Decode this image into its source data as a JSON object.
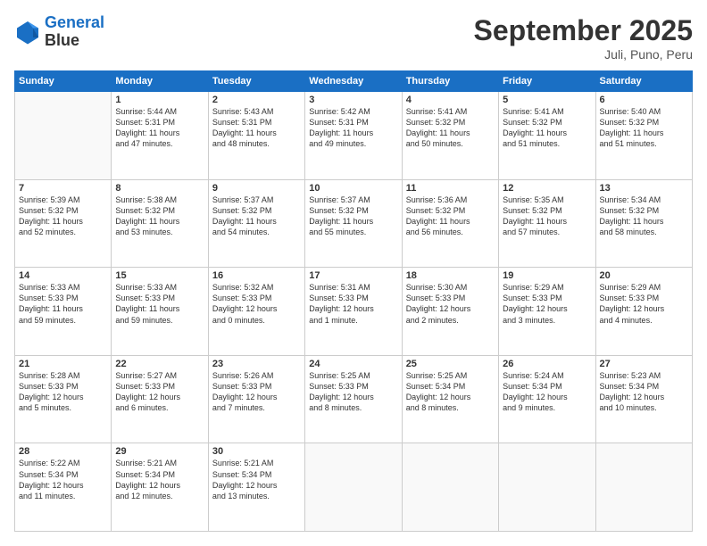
{
  "logo": {
    "line1": "General",
    "line2": "Blue"
  },
  "title": "September 2025",
  "location": "Juli, Puno, Peru",
  "days_header": [
    "Sunday",
    "Monday",
    "Tuesday",
    "Wednesday",
    "Thursday",
    "Friday",
    "Saturday"
  ],
  "weeks": [
    [
      {
        "day": "",
        "info": ""
      },
      {
        "day": "1",
        "info": "Sunrise: 5:44 AM\nSunset: 5:31 PM\nDaylight: 11 hours\nand 47 minutes."
      },
      {
        "day": "2",
        "info": "Sunrise: 5:43 AM\nSunset: 5:31 PM\nDaylight: 11 hours\nand 48 minutes."
      },
      {
        "day": "3",
        "info": "Sunrise: 5:42 AM\nSunset: 5:31 PM\nDaylight: 11 hours\nand 49 minutes."
      },
      {
        "day": "4",
        "info": "Sunrise: 5:41 AM\nSunset: 5:32 PM\nDaylight: 11 hours\nand 50 minutes."
      },
      {
        "day": "5",
        "info": "Sunrise: 5:41 AM\nSunset: 5:32 PM\nDaylight: 11 hours\nand 51 minutes."
      },
      {
        "day": "6",
        "info": "Sunrise: 5:40 AM\nSunset: 5:32 PM\nDaylight: 11 hours\nand 51 minutes."
      }
    ],
    [
      {
        "day": "7",
        "info": "Sunrise: 5:39 AM\nSunset: 5:32 PM\nDaylight: 11 hours\nand 52 minutes."
      },
      {
        "day": "8",
        "info": "Sunrise: 5:38 AM\nSunset: 5:32 PM\nDaylight: 11 hours\nand 53 minutes."
      },
      {
        "day": "9",
        "info": "Sunrise: 5:37 AM\nSunset: 5:32 PM\nDaylight: 11 hours\nand 54 minutes."
      },
      {
        "day": "10",
        "info": "Sunrise: 5:37 AM\nSunset: 5:32 PM\nDaylight: 11 hours\nand 55 minutes."
      },
      {
        "day": "11",
        "info": "Sunrise: 5:36 AM\nSunset: 5:32 PM\nDaylight: 11 hours\nand 56 minutes."
      },
      {
        "day": "12",
        "info": "Sunrise: 5:35 AM\nSunset: 5:32 PM\nDaylight: 11 hours\nand 57 minutes."
      },
      {
        "day": "13",
        "info": "Sunrise: 5:34 AM\nSunset: 5:32 PM\nDaylight: 11 hours\nand 58 minutes."
      }
    ],
    [
      {
        "day": "14",
        "info": "Sunrise: 5:33 AM\nSunset: 5:33 PM\nDaylight: 11 hours\nand 59 minutes."
      },
      {
        "day": "15",
        "info": "Sunrise: 5:33 AM\nSunset: 5:33 PM\nDaylight: 11 hours\nand 59 minutes."
      },
      {
        "day": "16",
        "info": "Sunrise: 5:32 AM\nSunset: 5:33 PM\nDaylight: 12 hours\nand 0 minutes."
      },
      {
        "day": "17",
        "info": "Sunrise: 5:31 AM\nSunset: 5:33 PM\nDaylight: 12 hours\nand 1 minute."
      },
      {
        "day": "18",
        "info": "Sunrise: 5:30 AM\nSunset: 5:33 PM\nDaylight: 12 hours\nand 2 minutes."
      },
      {
        "day": "19",
        "info": "Sunrise: 5:29 AM\nSunset: 5:33 PM\nDaylight: 12 hours\nand 3 minutes."
      },
      {
        "day": "20",
        "info": "Sunrise: 5:29 AM\nSunset: 5:33 PM\nDaylight: 12 hours\nand 4 minutes."
      }
    ],
    [
      {
        "day": "21",
        "info": "Sunrise: 5:28 AM\nSunset: 5:33 PM\nDaylight: 12 hours\nand 5 minutes."
      },
      {
        "day": "22",
        "info": "Sunrise: 5:27 AM\nSunset: 5:33 PM\nDaylight: 12 hours\nand 6 minutes."
      },
      {
        "day": "23",
        "info": "Sunrise: 5:26 AM\nSunset: 5:33 PM\nDaylight: 12 hours\nand 7 minutes."
      },
      {
        "day": "24",
        "info": "Sunrise: 5:25 AM\nSunset: 5:33 PM\nDaylight: 12 hours\nand 8 minutes."
      },
      {
        "day": "25",
        "info": "Sunrise: 5:25 AM\nSunset: 5:34 PM\nDaylight: 12 hours\nand 8 minutes."
      },
      {
        "day": "26",
        "info": "Sunrise: 5:24 AM\nSunset: 5:34 PM\nDaylight: 12 hours\nand 9 minutes."
      },
      {
        "day": "27",
        "info": "Sunrise: 5:23 AM\nSunset: 5:34 PM\nDaylight: 12 hours\nand 10 minutes."
      }
    ],
    [
      {
        "day": "28",
        "info": "Sunrise: 5:22 AM\nSunset: 5:34 PM\nDaylight: 12 hours\nand 11 minutes."
      },
      {
        "day": "29",
        "info": "Sunrise: 5:21 AM\nSunset: 5:34 PM\nDaylight: 12 hours\nand 12 minutes."
      },
      {
        "day": "30",
        "info": "Sunrise: 5:21 AM\nSunset: 5:34 PM\nDaylight: 12 hours\nand 13 minutes."
      },
      {
        "day": "",
        "info": ""
      },
      {
        "day": "",
        "info": ""
      },
      {
        "day": "",
        "info": ""
      },
      {
        "day": "",
        "info": ""
      }
    ]
  ]
}
